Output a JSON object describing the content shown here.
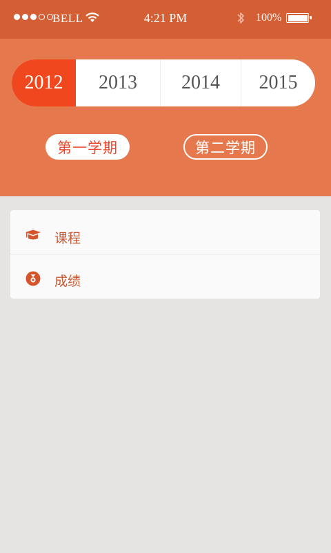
{
  "status_bar": {
    "carrier": "BELL",
    "time": "4:21 PM",
    "battery_percent": "100%",
    "signal_bars_filled": 3,
    "signal_bars_total": 5
  },
  "year_picker": {
    "years": [
      "2012",
      "2013",
      "2014",
      "2015"
    ],
    "selected": "2012"
  },
  "terms": {
    "first": "第一学期",
    "second": "第二学期",
    "selected": "第一学期"
  },
  "menu": {
    "items": [
      {
        "label": "课程",
        "icon": "graduation-cap-icon"
      },
      {
        "label": "成绩",
        "icon": "medal-icon"
      }
    ]
  },
  "colors": {
    "status_bar": "#d45f34",
    "header": "#e5794d",
    "accent": "#f0471e",
    "background": "#e5e4e2",
    "menu_text": "#c85a36"
  }
}
